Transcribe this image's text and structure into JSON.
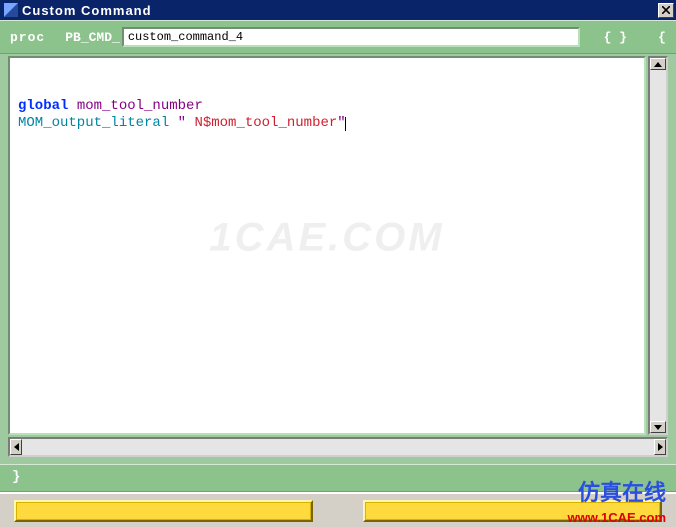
{
  "window": {
    "title": "Custom Command"
  },
  "header": {
    "proc_label": "proc",
    "prefix": "PB_CMD_",
    "command_name": "custom_command_4",
    "braces_open": "{ }    {"
  },
  "code": {
    "line1_kw": "global",
    "line1_rest": " mom_tool_number",
    "line2_fn": "MOM_output_literal",
    "line2_space": " ",
    "line2_q1": "\"",
    "line2_str": " N$mom_tool_number",
    "line2_q2": "\""
  },
  "footer": {
    "close_brace": "}"
  },
  "watermark": {
    "text": "1CAE.COM"
  },
  "overlay": {
    "cn": "仿真在线",
    "url": "www.1CAE.com"
  }
}
